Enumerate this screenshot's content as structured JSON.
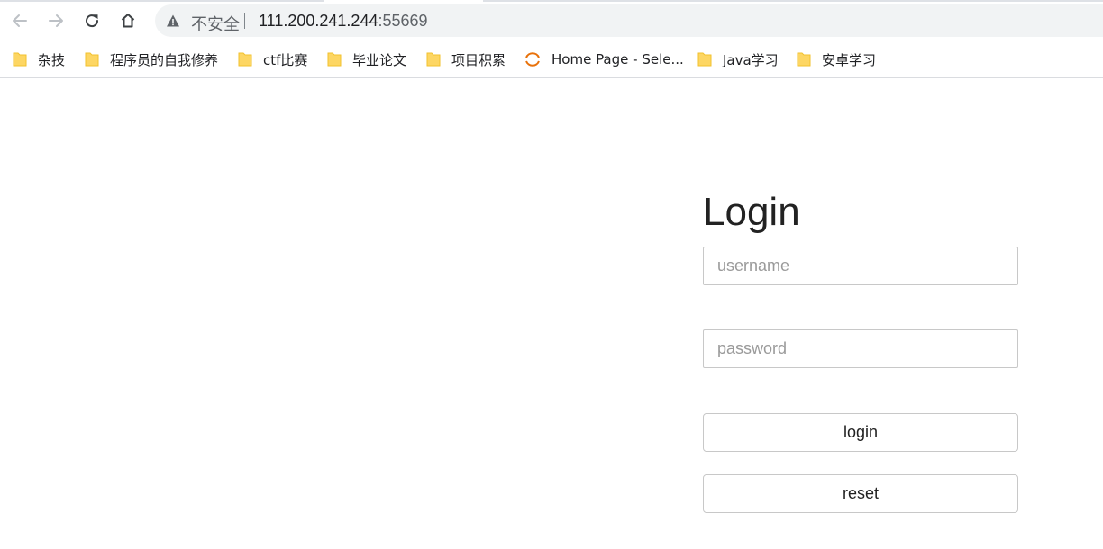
{
  "browser": {
    "security_label": "不安全",
    "url_host": "111.200.241.244",
    "url_port": ":55669",
    "icons": {
      "back": "back-arrow-icon",
      "forward": "forward-arrow-icon",
      "reload": "reload-icon",
      "home": "home-icon",
      "warning": "warning-icon"
    }
  },
  "bookmarks": [
    {
      "label": "杂技",
      "icon": "folder-icon"
    },
    {
      "label": "程序员的自我修养",
      "icon": "folder-icon"
    },
    {
      "label": "ctf比赛",
      "icon": "folder-icon"
    },
    {
      "label": "毕业论文",
      "icon": "folder-icon"
    },
    {
      "label": "项目积累",
      "icon": "folder-icon"
    },
    {
      "label": "Home Page - Sele...",
      "icon": "selenium-icon"
    },
    {
      "label": "Java学习",
      "icon": "folder-icon"
    },
    {
      "label": "安卓学习",
      "icon": "folder-icon"
    }
  ],
  "login": {
    "title": "Login",
    "username_placeholder": "username",
    "password_placeholder": "password",
    "login_label": "login",
    "reset_label": "reset"
  },
  "colors": {
    "folder": "#fdd663",
    "accent_selenium": "#e8710a",
    "omnibox_bg": "#f1f3f4"
  }
}
